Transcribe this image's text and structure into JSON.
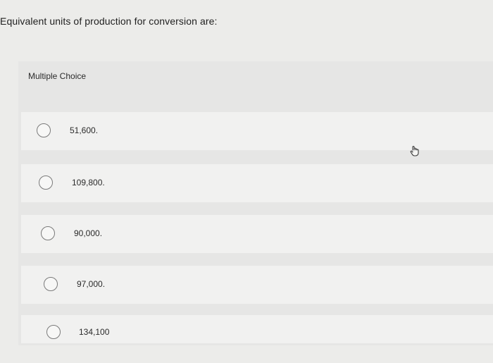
{
  "question": {
    "text": "Equivalent units of production for conversion are:"
  },
  "panel": {
    "title": "Multiple Choice"
  },
  "options": [
    {
      "label": "51,600."
    },
    {
      "label": "109,800."
    },
    {
      "label": "90,000."
    },
    {
      "label": "97,000."
    },
    {
      "label": "134,100"
    }
  ],
  "icons": {
    "radio": "radio-button-icon",
    "cursor": "hand-pointer-icon"
  }
}
